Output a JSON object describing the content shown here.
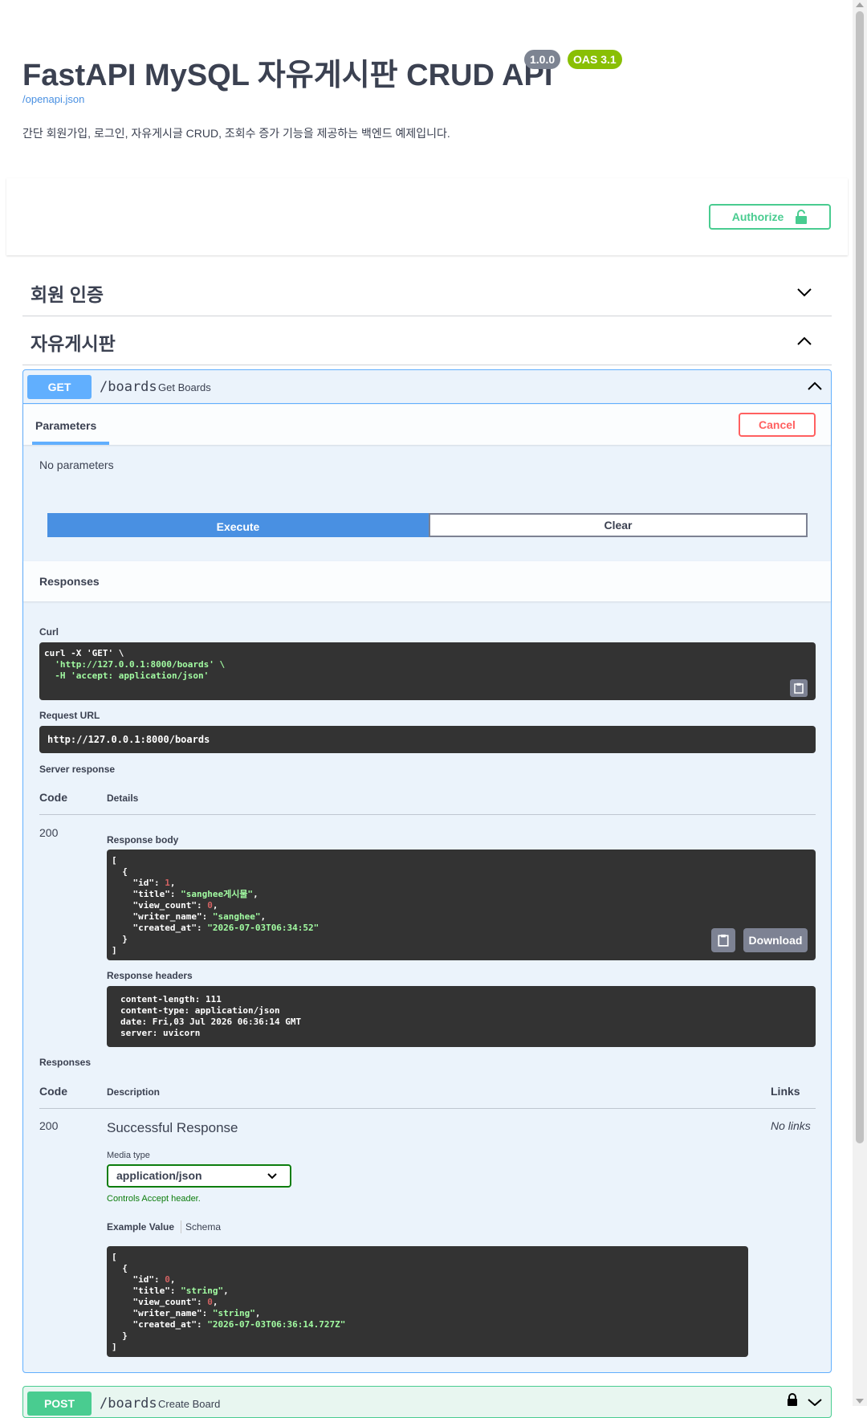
{
  "header": {
    "title": "FastAPI MySQL 자유게시판 CRUD API",
    "version_badge": "1.0.0",
    "oas_badge": "OAS 3.1",
    "spec_link": "/openapi.json",
    "description": "간단 회원가입, 로그인, 자유게시글 CRUD, 조회수 증가 기능을 제공하는 백엔드 예제입니다."
  },
  "authorize_label": "Authorize",
  "tags": [
    {
      "name": "회원 인증",
      "expanded": false
    },
    {
      "name": "자유게시판",
      "expanded": true
    }
  ],
  "operation": {
    "method": "GET",
    "path": "/boards",
    "summary": "Get Boards",
    "tab_label": "Parameters",
    "cancel_label": "Cancel",
    "no_params": "No parameters",
    "execute_label": "Execute",
    "clear_label": "Clear",
    "responses_title": "Responses",
    "curl_label": "Curl",
    "curl_lines": [
      "curl -X 'GET' \\",
      "  'http://127.0.0.1:8000/boards' \\",
      "  -H 'accept: application/json'"
    ],
    "request_url_label": "Request URL",
    "request_url": "http://127.0.0.1:8000/boards",
    "server_response_label": "Server response",
    "code_header": "Code",
    "details_header": "Details",
    "status_code": "200",
    "response_body_label": "Response body",
    "response_body": {
      "id": "1",
      "title": "\"sanghee게시물\"",
      "view_count": "0",
      "writer_name": "\"sanghee\"",
      "created_at": "\"2026-07-03T06:34:52\""
    },
    "download_label": "Download",
    "response_headers_label": "Response headers",
    "response_headers": [
      "content-length: 111",
      "content-type: application/json",
      "date: Fri,03 Jul 2026 06:36:14 GMT",
      "server: uvicorn"
    ],
    "responses_label": "Responses",
    "description_header": "Description",
    "links_header": "Links",
    "doc_code": "200",
    "doc_description": "Successful Response",
    "no_links": "No links",
    "media_type_label": "Media type",
    "media_type_value": "application/json",
    "accept_note": "Controls Accept header.",
    "example_tab": "Example Value",
    "schema_tab": "Schema",
    "example_body": {
      "id": "0",
      "title": "\"string\"",
      "view_count": "0",
      "writer_name": "\"string\"",
      "created_at": "\"2026-07-03T06:36:14.727Z\""
    }
  },
  "next_operation": {
    "method": "POST",
    "path": "/boards",
    "summary": "Create Board"
  },
  "colors": {
    "get": "#61affe",
    "post": "#49cc90",
    "cancel": "#ff6060",
    "execute": "#4990e2",
    "code_bg": "#333333"
  }
}
